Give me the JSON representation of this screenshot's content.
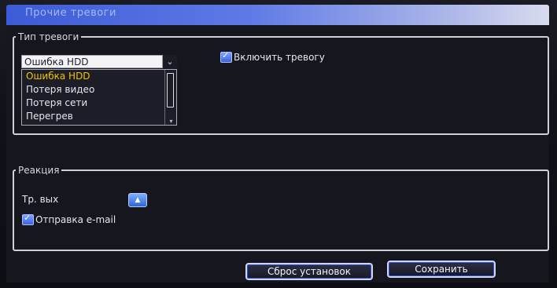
{
  "window": {
    "title": "Прочие тревоги"
  },
  "alarm_type": {
    "legend": "Тип тревоги",
    "selected": "Ошибка HDD",
    "options": [
      "Ошибка HDD",
      "Потеря видео",
      "Потеря сети",
      "Перегрев"
    ],
    "enable_label": "Включить тревогу",
    "enable_checked": true
  },
  "reaction": {
    "legend": "Реакция",
    "output_label": "Тр. вых",
    "email_label": "Отправка e-mail",
    "email_checked": true
  },
  "buttons": {
    "reset_label": "Сброс установок",
    "save_label": "Сохранить"
  },
  "colors": {
    "titlebar_accent": "#3d5bd6",
    "selected_item": "#f2c400",
    "checkbox_blue": "#3c64e0"
  }
}
